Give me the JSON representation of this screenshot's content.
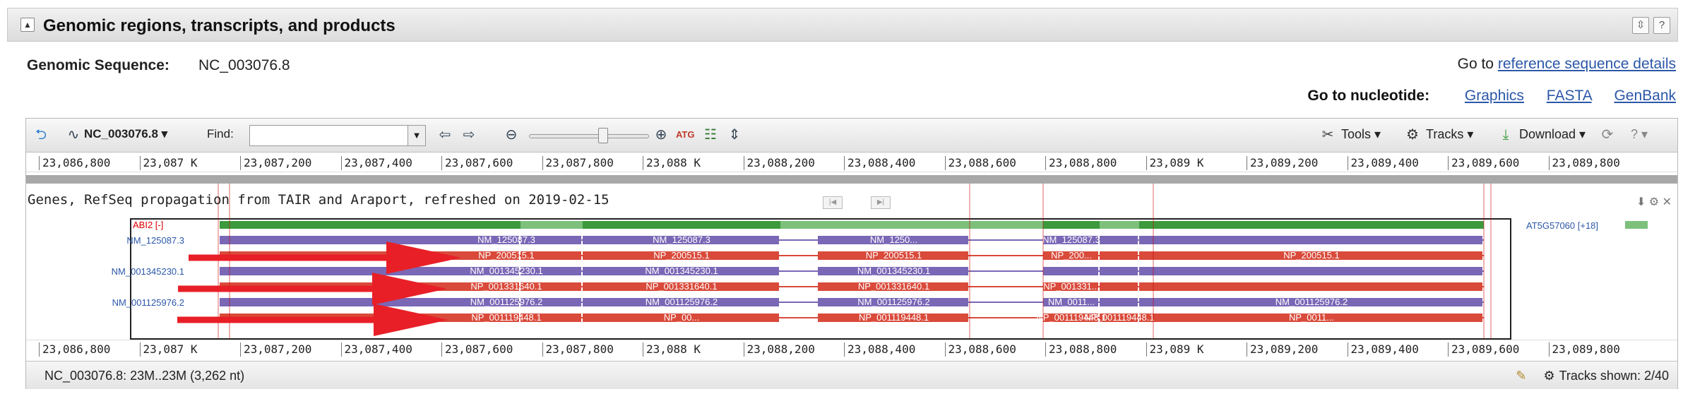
{
  "section": {
    "collapse_glyph": "▲",
    "title": "Genomic regions, transcripts, and products",
    "icons": [
      "expand-all-icon",
      "help-icon"
    ],
    "icon_glyphs": [
      "⇳",
      "?"
    ]
  },
  "genomic_sequence": {
    "label": "Genomic Sequence:",
    "value": "NC_003076.8",
    "goto_prefix": "Go to",
    "goto_link": "reference sequence details"
  },
  "nucleotide": {
    "label": "Go to nucleotide:",
    "links": [
      "Graphics",
      "FASTA",
      "GenBank"
    ]
  },
  "toolbar": {
    "sequence": "NC_003076.8 ▾",
    "find_label": "Find:",
    "find_value": "",
    "tools": "Tools ▾",
    "tracks": "Tracks ▾",
    "download": "Download ▾",
    "help": "? ▾",
    "zoom_level": 0.55
  },
  "ruler": {
    "labels": [
      "23,086,800",
      "23,087 K",
      "23,087,200",
      "23,087,400",
      "23,087,600",
      "23,087,800",
      "23,088 K",
      "23,088,200",
      "23,088,400",
      "23,088,600",
      "23,088,800",
      "23,089 K",
      "23,089,200",
      "23,089,400",
      "23,089,600",
      "23,089,800"
    ]
  },
  "track": {
    "title": "Genes, RefSeq propagation from TAIR and Araport, refreshed on 2019-02-15",
    "gene_label": "ABI2 [-]",
    "neighbor_gene": "AT5G57060 [+18]",
    "tool_glyphs": "⬇ ⚙ ✕",
    "rows": [
      {
        "left_label": "NM_125087.3",
        "kind": "rna",
        "center": "NM_125087.3",
        "extra": [
          "NM_125087.3",
          "NM_1250...",
          "NM_125087.3"
        ]
      },
      {
        "left_label": "",
        "kind": "protein",
        "center": "NP_200515.1",
        "extra": [
          "NP_200515.1",
          "NP_200515.1",
          "NP_200...",
          "NP_200515.1"
        ]
      },
      {
        "left_label": "NM_001345230.1",
        "kind": "rna",
        "center": "NM_001345230.1",
        "extra": [
          "NM_001345230.1",
          "NM_001345230.1"
        ]
      },
      {
        "left_label": "",
        "kind": "protein",
        "center": "NP_001331640.1",
        "extra": [
          "NP_001331640.1",
          "NP_001331640.1",
          "NP_001331..."
        ]
      },
      {
        "left_label": "NM_001125976.2",
        "kind": "rna",
        "center": "NM_001125976.2",
        "extra": [
          "NM_001125976.2",
          "NM_001125976.2",
          "NM_0011...",
          "NM_001125976.2"
        ]
      },
      {
        "left_label": "",
        "kind": "protein",
        "center": "NP_001119448.1",
        "extra": [
          "NP_00...",
          "NP_001119448.1",
          "NP_001119448.1",
          "NP_0011...",
          "NP_001119448.1"
        ]
      }
    ]
  },
  "status": {
    "range": "NC_003076.8: 23M..23M (3,262 nt)",
    "tracks_shown": "Tracks shown: 2/40"
  },
  "colors": {
    "gene": "#3c9a3c",
    "gene_light": "#7cc07c",
    "rna": "#7a67b6",
    "protein": "#d94a3a",
    "annotation_arrow": "#e81f27"
  }
}
